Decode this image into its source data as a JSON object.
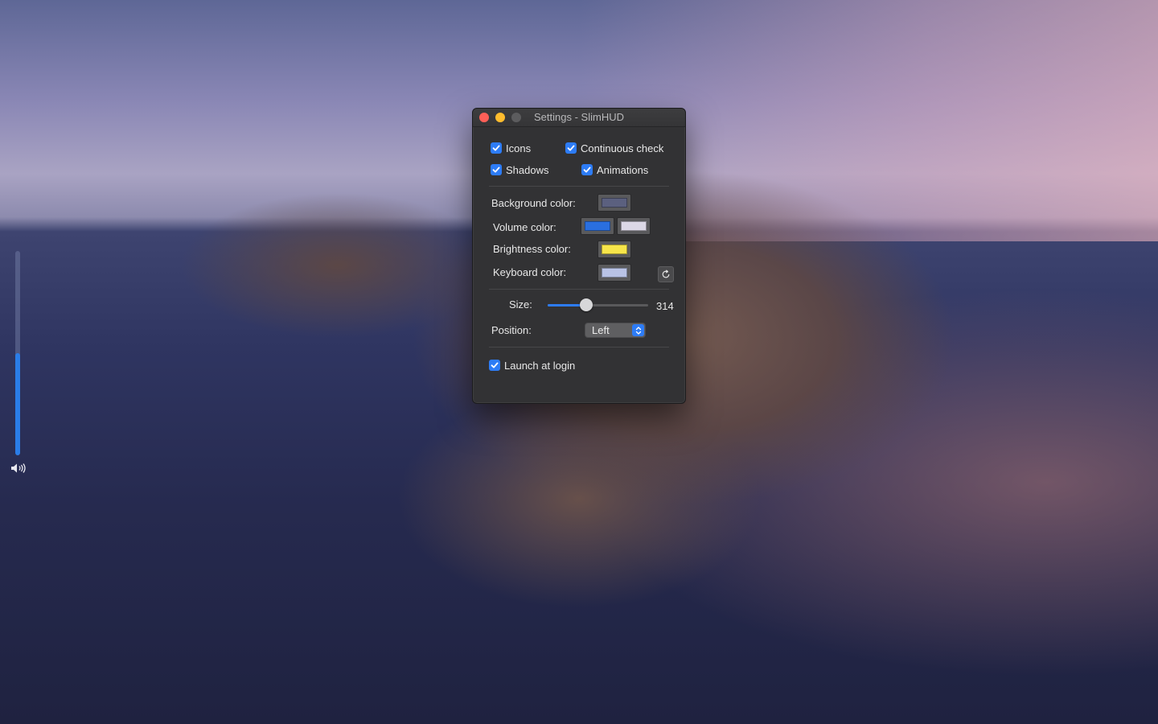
{
  "hud": {
    "volume_level": 0.5,
    "accent_color": "#2a7de8",
    "icon": "speaker-icon"
  },
  "window": {
    "title": "Settings - SlimHUD",
    "checkboxes": {
      "icons": {
        "label": "Icons",
        "checked": true
      },
      "continuous_check": {
        "label": "Continuous check",
        "checked": true
      },
      "shadows": {
        "label": "Shadows",
        "checked": true
      },
      "animations": {
        "label": "Animations",
        "checked": true
      },
      "launch_at_login": {
        "label": "Launch at login",
        "checked": true
      }
    },
    "colors": {
      "background_label": "Background color:",
      "background_value": "#5b607f",
      "volume_label": "Volume color:",
      "volume_value": "#2a6fdf",
      "volume_value_2": "#dcd8e6",
      "brightness_label": "Brightness color:",
      "brightness_value": "#f7e54a",
      "keyboard_label": "Keyboard color:",
      "keyboard_value": "#b9c3e6"
    },
    "size": {
      "label": "Size:",
      "value": "314",
      "slider_fraction": 0.38
    },
    "position": {
      "label": "Position:",
      "selected": "Left"
    },
    "accent_color": "#2d7cf6"
  }
}
